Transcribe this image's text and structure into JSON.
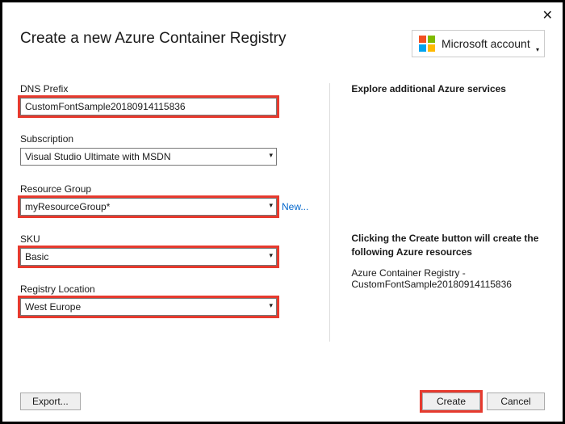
{
  "title": "Create a new Azure Container Registry",
  "account_label": "Microsoft account",
  "left": {
    "dns": {
      "label": "DNS Prefix",
      "value": "CustomFontSample20180914115836"
    },
    "subscription": {
      "label": "Subscription",
      "value": "Visual Studio Ultimate with MSDN"
    },
    "resource_group": {
      "label": "Resource Group",
      "value": "myResourceGroup*",
      "new_link": "New..."
    },
    "sku": {
      "label": "SKU",
      "value": "Basic"
    },
    "location": {
      "label": "Registry Location",
      "value": "West Europe"
    }
  },
  "right": {
    "explore_title": "Explore additional Azure services",
    "create_title": "Clicking the Create button will create the following Azure resources",
    "resource_line": "Azure Container Registry - CustomFontSample20180914115836"
  },
  "footer": {
    "export": "Export...",
    "create": "Create",
    "cancel": "Cancel"
  }
}
